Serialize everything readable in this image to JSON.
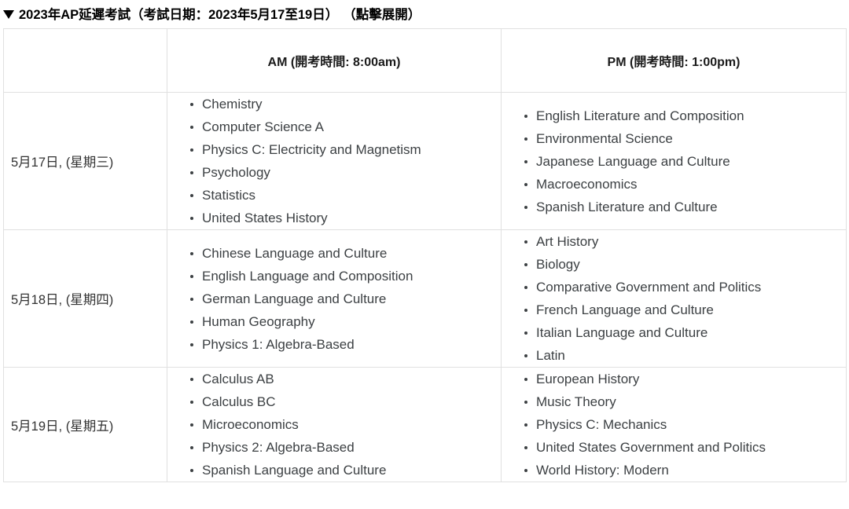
{
  "header": {
    "toggle_icon": "triangle-down-icon",
    "title": "2023年AP延遲考試（考試日期：2023年5月17至19日）",
    "hint": "（點擊展開）"
  },
  "table": {
    "columns": [
      {
        "key": "date",
        "label": ""
      },
      {
        "key": "am",
        "label": "AM (開考時間: 8:00am)"
      },
      {
        "key": "pm",
        "label": "PM (開考時間: 1:00pm)"
      }
    ],
    "rows": [
      {
        "date": "5月17日, (星期三)",
        "am": [
          "Chemistry",
          "Computer Science A",
          "Physics C: Electricity and Magnetism",
          "Psychology",
          "Statistics",
          "United States History"
        ],
        "pm": [
          "English Literature and Composition",
          "Environmental Science",
          "Japanese Language and Culture",
          "Macroeconomics",
          "Spanish Literature and Culture"
        ]
      },
      {
        "date": "5月18日, (星期四)",
        "am": [
          "Chinese Language and Culture",
          "English Language and Composition",
          "German Language and Culture",
          "Human Geography",
          "Physics 1: Algebra-Based"
        ],
        "pm": [
          "Art History",
          "Biology",
          "Comparative Government and Politics",
          "French Language and Culture",
          "Italian Language and Culture",
          "Latin"
        ]
      },
      {
        "date": "5月19日, (星期五)",
        "am": [
          "Calculus AB",
          "Calculus BC",
          "Microeconomics",
          "Physics 2: Algebra-Based",
          "Spanish Language and Culture"
        ],
        "pm": [
          "European History",
          "Music Theory",
          "Physics C: Mechanics",
          "United States Government and Politics",
          "World History: Modern"
        ]
      }
    ]
  },
  "colors": {
    "border": "#e0e0e0",
    "text_primary": "#3c4043",
    "text_heading": "#1a1a1a",
    "text_date": "#333333",
    "background": "#ffffff"
  }
}
